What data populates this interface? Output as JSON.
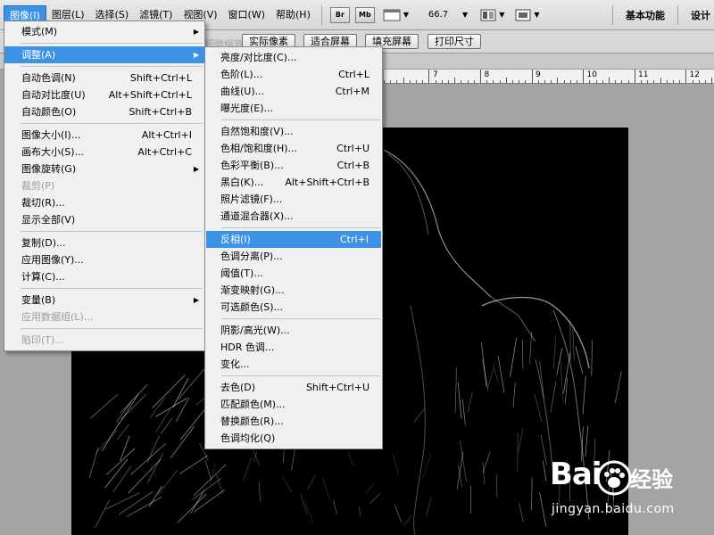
{
  "menubar": {
    "items": [
      {
        "label": "图像(I)",
        "active": true
      },
      {
        "label": "图层(L)"
      },
      {
        "label": "选择(S)"
      },
      {
        "label": "滤镜(T)"
      },
      {
        "label": "视图(V)"
      },
      {
        "label": "窗口(W)"
      },
      {
        "label": "帮助(H)"
      }
    ],
    "br_label": "Br",
    "mb_label": "Mb",
    "zoom": "66.7",
    "workspace": "基本功能",
    "workspace_more": "设计"
  },
  "options_bar": {
    "dim_label": "细微缩放",
    "actual_pixels": "实际像素",
    "fit_screen": "适合屏幕",
    "fill_screen": "填充屏幕",
    "print_size": "打印尺寸"
  },
  "ruler": {
    "labels": [
      "7",
      "8",
      "9",
      "10",
      "11",
      "12"
    ]
  },
  "image_menu": {
    "items": [
      {
        "label": "模式(M)",
        "submenu": true
      },
      {
        "sep": true
      },
      {
        "label": "调整(A)",
        "submenu": true,
        "highlight": true
      },
      {
        "sep": true
      },
      {
        "label": "自动色调(N)",
        "shortcut": "Shift+Ctrl+L"
      },
      {
        "label": "自动对比度(U)",
        "shortcut": "Alt+Shift+Ctrl+L"
      },
      {
        "label": "自动颜色(O)",
        "shortcut": "Shift+Ctrl+B"
      },
      {
        "sep": true
      },
      {
        "label": "图像大小(I)...",
        "shortcut": "Alt+Ctrl+I"
      },
      {
        "label": "画布大小(S)...",
        "shortcut": "Alt+Ctrl+C"
      },
      {
        "label": "图像旋转(G)",
        "submenu": true
      },
      {
        "label": "裁剪(P)",
        "disabled": true
      },
      {
        "label": "裁切(R)..."
      },
      {
        "label": "显示全部(V)"
      },
      {
        "sep": true
      },
      {
        "label": "复制(D)..."
      },
      {
        "label": "应用图像(Y)..."
      },
      {
        "label": "计算(C)..."
      },
      {
        "sep": true
      },
      {
        "label": "变量(B)",
        "submenu": true
      },
      {
        "label": "应用数据组(L)...",
        "disabled": true
      },
      {
        "sep": true
      },
      {
        "label": "陷印(T)...",
        "disabled": true
      }
    ]
  },
  "adjust_menu": {
    "items": [
      {
        "label": "亮度/对比度(C)..."
      },
      {
        "label": "色阶(L)...",
        "shortcut": "Ctrl+L"
      },
      {
        "label": "曲线(U)...",
        "shortcut": "Ctrl+M"
      },
      {
        "label": "曝光度(E)..."
      },
      {
        "sep": true
      },
      {
        "label": "自然饱和度(V)..."
      },
      {
        "label": "色相/饱和度(H)...",
        "shortcut": "Ctrl+U"
      },
      {
        "label": "色彩平衡(B)...",
        "shortcut": "Ctrl+B"
      },
      {
        "label": "黑白(K)...",
        "shortcut": "Alt+Shift+Ctrl+B"
      },
      {
        "label": "照片滤镜(F)..."
      },
      {
        "label": "通道混合器(X)..."
      },
      {
        "sep": true
      },
      {
        "label": "反相(I)",
        "shortcut": "Ctrl+I",
        "highlight": true
      },
      {
        "label": "色调分离(P)..."
      },
      {
        "label": "阈值(T)..."
      },
      {
        "label": "渐变映射(G)..."
      },
      {
        "label": "可选颜色(S)..."
      },
      {
        "sep": true
      },
      {
        "label": "阴影/高光(W)..."
      },
      {
        "label": "HDR 色调..."
      },
      {
        "label": "变化..."
      },
      {
        "sep": true
      },
      {
        "label": "去色(D)",
        "shortcut": "Shift+Ctrl+U"
      },
      {
        "label": "匹配颜色(M)..."
      },
      {
        "label": "替换颜色(R)..."
      },
      {
        "label": "色调均化(Q)"
      }
    ]
  },
  "watermark": {
    "brand": "Bai",
    "brand_suffix": "经验",
    "url": "jingyan.baidu.com"
  },
  "colors": {
    "highlight": "#3c93e6",
    "menu_bg": "#f0f0f0",
    "canvas": "#000000"
  }
}
